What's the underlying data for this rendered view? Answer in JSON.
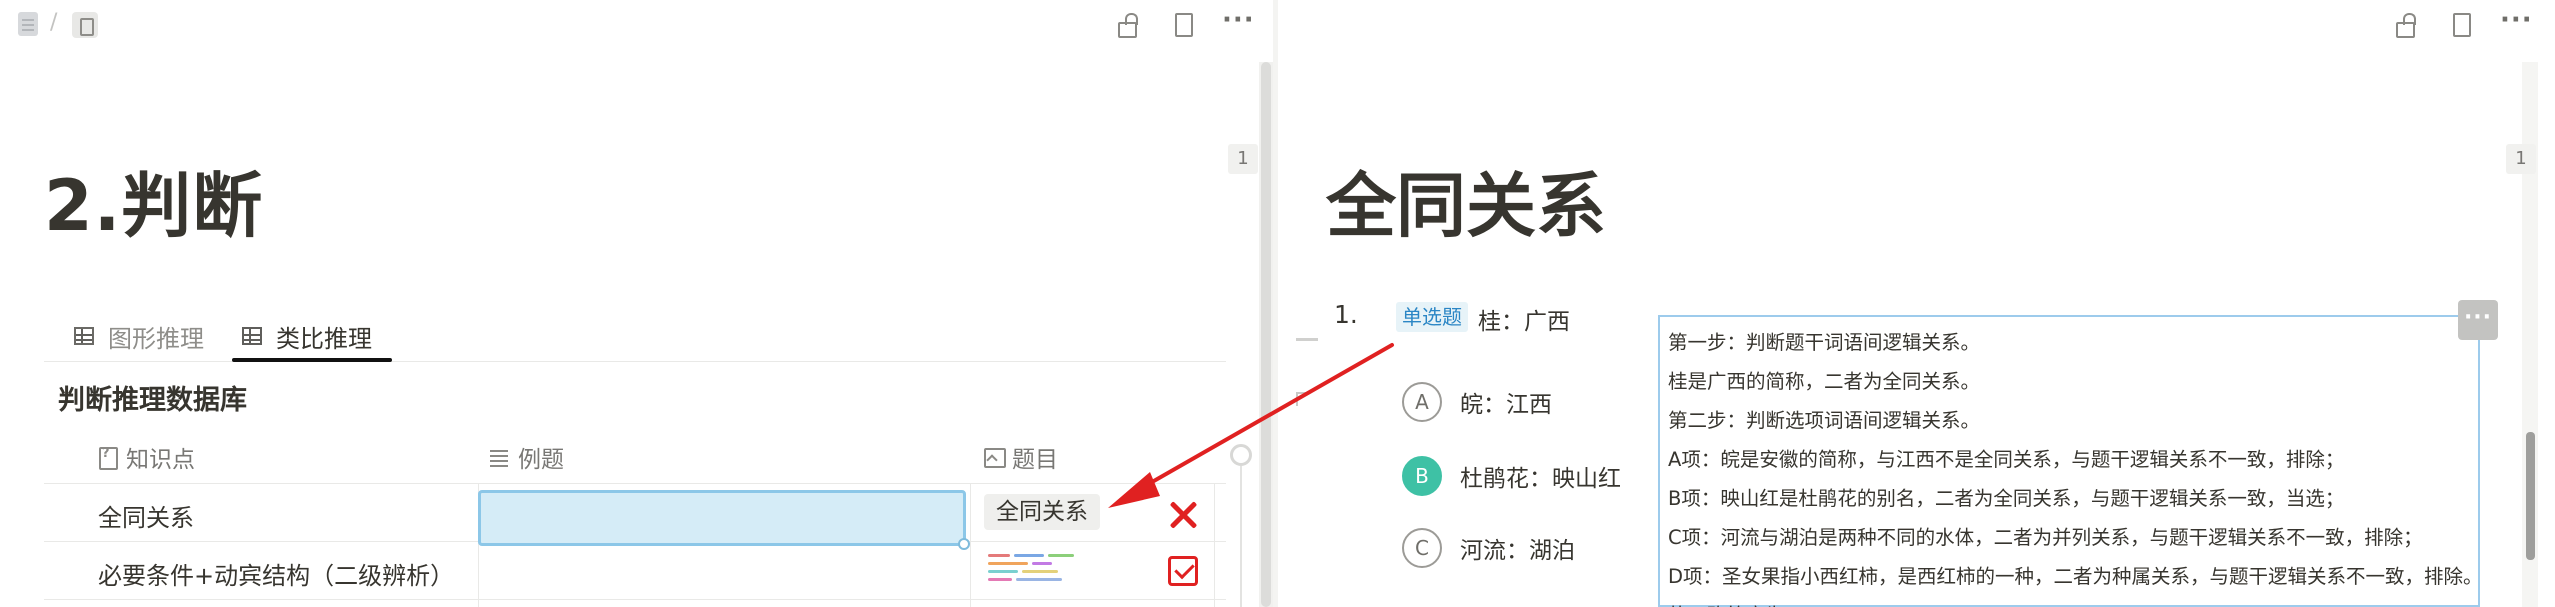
{
  "left": {
    "breadcrumb": {
      "separator": "/"
    },
    "page_number": "1",
    "title": "2.判断",
    "tabs": [
      {
        "label": "图形推理"
      },
      {
        "label": "类比推理"
      }
    ],
    "database_title": "判断推理数据库",
    "columns": [
      "知识点",
      "例题",
      "题目"
    ],
    "rows": [
      {
        "knowledge_point": "全同关系",
        "example": "",
        "topic": "全同关系",
        "status_icon": "x-icon"
      },
      {
        "knowledge_point": "必要条件+动宾结构（二级辨析）",
        "example": "",
        "topic": "",
        "status_icon": "checkbox-icon"
      }
    ],
    "colors": {
      "error_red": "#e02121",
      "selection_blue": "#d5ecf7"
    }
  },
  "right": {
    "page_number": "1",
    "title": "全同关系",
    "question": {
      "number": "1.",
      "type_badge": "单选题",
      "stem": "桂：广西",
      "options": [
        {
          "letter": "A",
          "text": "皖：江西",
          "selected": false
        },
        {
          "letter": "B",
          "text": "杜鹃花：映山红",
          "selected": true
        },
        {
          "letter": "C",
          "text": "河流：湖泊",
          "selected": false
        }
      ]
    },
    "answer_lines": [
      "第一步：判断题干词语间逻辑关系。",
      "桂是广西的简称，二者为全同关系。",
      "第二步：判断选项词语间逻辑关系。",
      "A项：皖是安徽的简称，与江西不是全同关系，与题干逻辑关系不一致，排除；",
      "B项：映山红是杜鹃花的别名，二者为全同关系，与题干逻辑关系一致，当选；",
      "C项：河流与湖泊是两种不同的水体，二者为并列关系，与题干逻辑关系不一致，排除；",
      "D项：圣女果指小西红柿，是西红柿的一种，二者为种属关系，与题干逻辑关系不一致，排除。",
      "故正确答案为B。"
    ],
    "colors": {
      "selected_option": "#3ec1a5",
      "badge_text": "#2b86c5"
    }
  }
}
